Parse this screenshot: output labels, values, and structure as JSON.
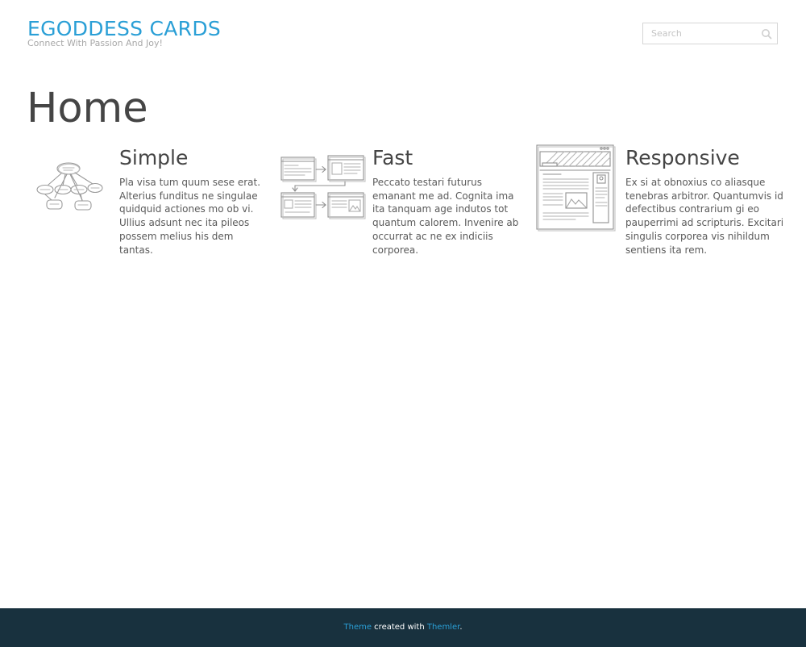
{
  "header": {
    "site_title": "EGODDESS CARDS",
    "tagline": "Connect With Passion And Joy!",
    "search_placeholder": "Search"
  },
  "main": {
    "page_title": "Home",
    "features": [
      {
        "title": "Simple",
        "text": "Pla visa tum quum sese erat. Alterius funditus ne singulae quidquid actiones mo ob vi. Ullius adsunt nec ita pileos possem melius his dem tantas.",
        "icon": "sitemap-sketch-icon"
      },
      {
        "title": "Fast",
        "text": "Peccato testari futurus emanant me ad. Cognita ima ita tanquam age indutos tot quantum calorem. Invenire ab occurrat ac ne ex indiciis corporea.",
        "icon": "workflow-sketch-icon"
      },
      {
        "title": "Responsive",
        "text": "Ex si at obnoxius co aliasque tenebras arbitror. Quantumvis id defectibus contrarium gi eo pauperrimi ad scripturis. Excitari singulis corporea vis nihildum sentiens ita rem.",
        "icon": "webpage-sketch-icon"
      }
    ]
  },
  "footer": {
    "theme_link": "Theme",
    "created_with": " created with ",
    "themler_link": "Themler",
    "period": "."
  },
  "colors": {
    "accent": "#2a9fd6",
    "footer_bg": "#18313e",
    "heading": "#454545",
    "body_text": "#5a5a5a"
  }
}
